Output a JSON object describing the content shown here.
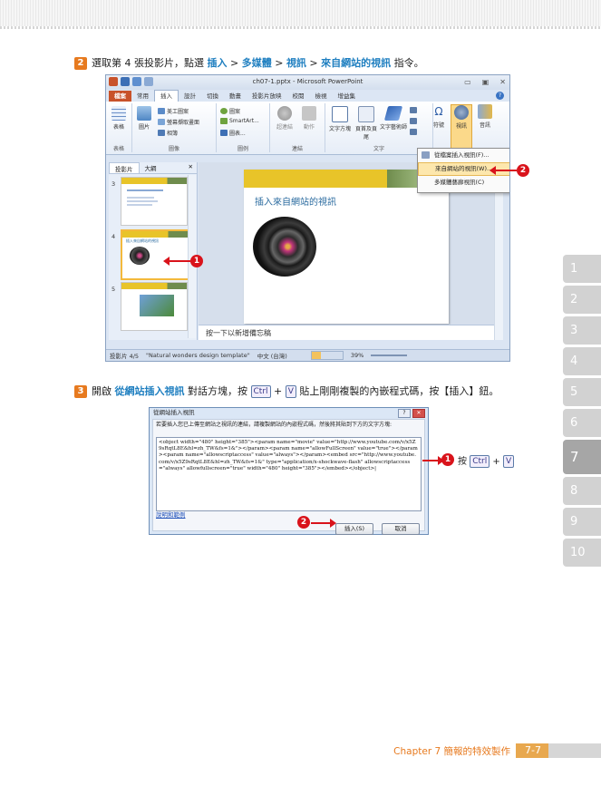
{
  "step2": {
    "num": "2",
    "pre": "選取第 4 張投影片，點選 ",
    "path": [
      {
        "text": "插入",
        "kind": "hl"
      },
      {
        "text": " > ",
        "kind": "sep"
      },
      {
        "text": "多媒體",
        "kind": "hl"
      },
      {
        "text": " > ",
        "kind": "sep"
      },
      {
        "text": "視訊",
        "kind": "hl"
      },
      {
        "text": " > ",
        "kind": "sep"
      },
      {
        "text": "來自網站的視訊",
        "kind": "hl"
      }
    ],
    "post": " 指令。"
  },
  "ppt": {
    "title": "ch07-1.pptx - Microsoft PowerPoint",
    "window_buttons": [
      "▭",
      "▣",
      "✕"
    ],
    "tabs": [
      "檔案",
      "常用",
      "插入",
      "設計",
      "切換",
      "動畫",
      "投影片放映",
      "校閱",
      "檢視",
      "增益集"
    ],
    "active_tab": "插入",
    "ribbon": {
      "table": "表格",
      "picture": "圖片",
      "clipart": "美工圖案",
      "screenshot": "螢幕擷取畫面",
      "album": "相簿",
      "shapes": "圖案",
      "smartart": "SmartArt...",
      "chart": "圖表...",
      "hyperlink": "超連結",
      "action": "動作",
      "textbox": "文字方塊",
      "header": "頁首及頁尾",
      "wordart": "文字藝術師",
      "symbol": "符號",
      "video": "視訊",
      "audio": "音訊",
      "groups": [
        "表格",
        "圖像",
        "圖例",
        "連結",
        "文字"
      ]
    },
    "video_menu": [
      "從檔案插入視訊(F)...",
      "來自網站的視訊(W)...",
      "多媒體藝廊視訊(C)"
    ],
    "pane_tabs": [
      "投影片",
      "大綱"
    ],
    "pane_close": "✕",
    "thumb_nums": [
      "3",
      "4",
      "5"
    ],
    "thumb4_title": "插入來自網站的視訊",
    "slide_title": "插入來自網站的視訊",
    "notes": "按一下以新增備忘稿",
    "status": {
      "slide": "投影片 4/5",
      "theme": "\"Natural wonders design template\"",
      "lang": "中文 (台灣)",
      "zoom": "39%"
    }
  },
  "step3": {
    "num": "3",
    "t1": "開啟 ",
    "dialog_name": "從網站插入視訊",
    "t2": " 對話方塊，按 ",
    "key1": "Ctrl",
    "plus": " + ",
    "key2": "V",
    "t3": " 貼上剛剛複製的內嵌程式碼，按【插入】鈕。"
  },
  "dialog": {
    "title": "從網站插入視訊",
    "buttons": [
      "?",
      "✕"
    ],
    "desc": "若要插入您已上傳至網站之視訊的連結，請複製網站的內嵌程式碼，然後將其貼到下方的文字方塊:",
    "code": "<object width=\"480\" height=\"385\"><param name=\"movie\" value=\"http://www.youtube.com/v/x5Z9sRqtL8E&hl=zh_TW&fs=1&\"></param><param name=\"allowFullScreen\" value=\"true\"></param><param name=\"allowscriptaccess\" value=\"always\"></param><embed src=\"http://www.youtube.com/v/x5Z9sRqtL8E&hl=zh_TW&fs=1&\" type=\"application/x-shockwave-flash\" allowscriptaccess=\"always\" allowfullscreen=\"true\" width=\"480\" height=\"385\"></embed></object>|",
    "help_link": "說明和範例",
    "insert": "插入(S)",
    "cancel": "取消"
  },
  "callouts": {
    "c1a": "1",
    "c2a": "2",
    "c1b": "1",
    "c1b_text": "按",
    "c1b_key1": "Ctrl",
    "c1b_plus": "+",
    "c1b_key2": "V",
    "c2b": "2"
  },
  "sidetabs": [
    "1",
    "2",
    "3",
    "4",
    "5",
    "6",
    "7",
    "8",
    "9",
    "10"
  ],
  "active_sidetab": "7",
  "footer": {
    "text": "Chapter 7  簡報的特效製作",
    "page": "7-7"
  },
  "colors": {
    "accent": "#e77a1f",
    "link_blue": "#1f7fc0",
    "callout_red": "#d9131b"
  }
}
